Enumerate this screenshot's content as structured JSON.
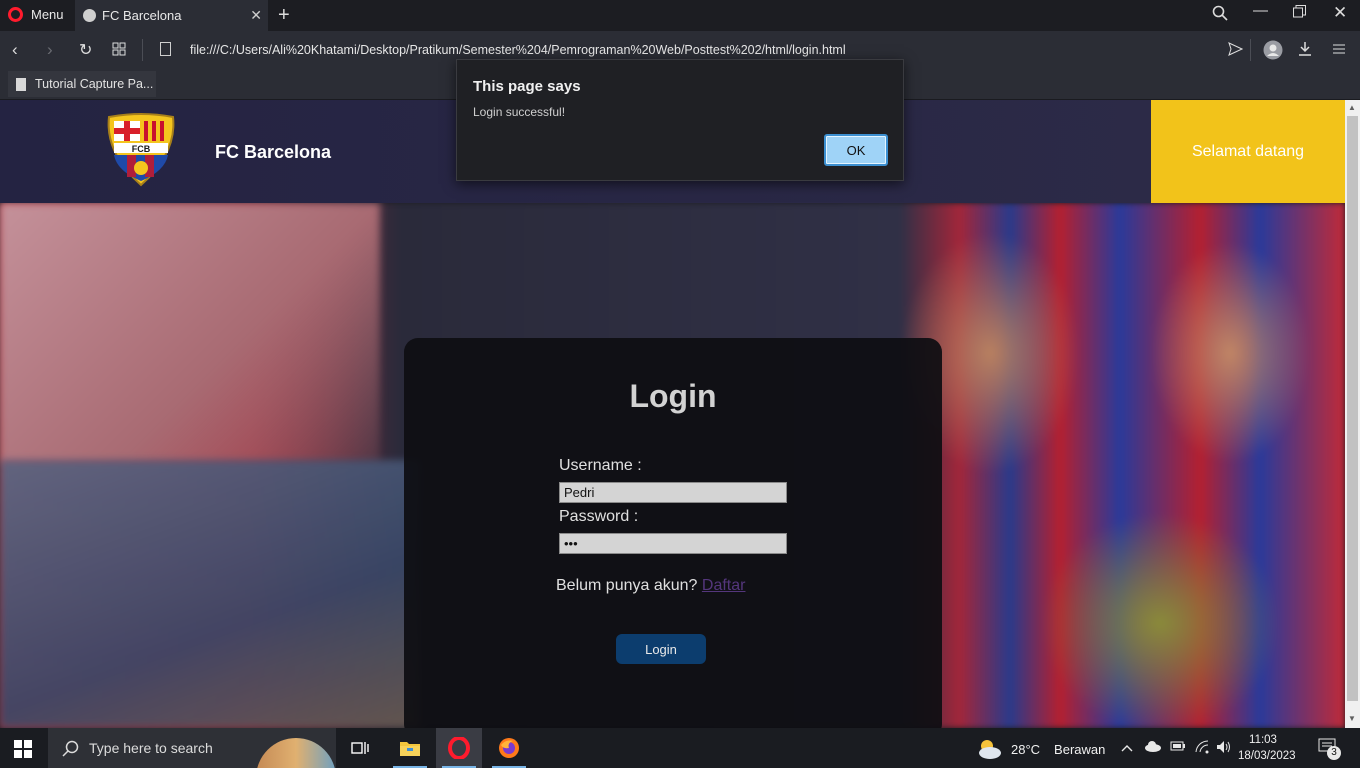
{
  "browser": {
    "menu_label": "Menu",
    "tab_title": "FC Barcelona",
    "url": "file:///C:/Users/Ali%20Khatami/Desktop/Pratikum/Semester%204/Pemrograman%20Web/Posttest%202/html/login.html",
    "bookmark_label": "Tutorial Capture Pa..."
  },
  "header": {
    "brand": "FC Barcelona",
    "welcome": "Selamat datang",
    "logo_text": "FCB"
  },
  "login": {
    "title": "Login",
    "username_label": "Username :",
    "username_value": "Pedri",
    "password_label": "Password :",
    "password_value": "•••",
    "signup_text": "Belum punya akun?",
    "signup_link": "Daftar",
    "button": "Login"
  },
  "dialog": {
    "title": "This page says",
    "message": "Login successful!",
    "ok": "OK"
  },
  "taskbar": {
    "search_placeholder": "Type here to search",
    "temperature": "28°C",
    "weather": "Berawan",
    "time": "11:03",
    "date": "18/03/2023",
    "notifications": "3"
  },
  "colors": {
    "header_bg": "#242342",
    "welcome_bg": "#f2c31a",
    "login_button": "#0c3d6e",
    "link": "#54367c"
  }
}
